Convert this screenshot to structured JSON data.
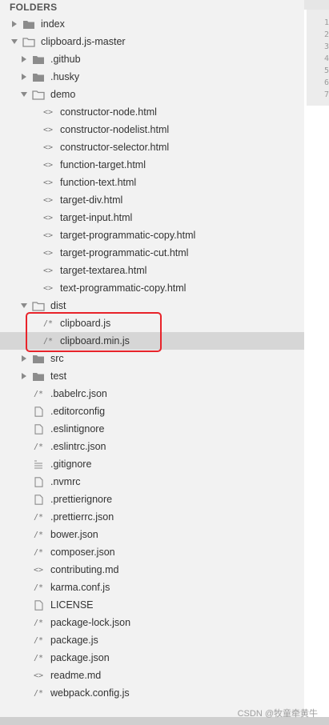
{
  "sidebar": {
    "title": "FOLDERS",
    "items": [
      {
        "label": "index",
        "icon": "folder-icon",
        "arrow": "right",
        "depth": 0
      },
      {
        "label": "clipboard.js-master",
        "icon": "folder-open-icon",
        "arrow": "down",
        "depth": 0
      },
      {
        "label": ".github",
        "icon": "folder-icon",
        "arrow": "right",
        "depth": 1
      },
      {
        "label": ".husky",
        "icon": "folder-icon",
        "arrow": "right",
        "depth": 1
      },
      {
        "label": "demo",
        "icon": "folder-open-icon",
        "arrow": "down",
        "depth": 1
      },
      {
        "label": "constructor-node.html",
        "icon": "code-file-icon",
        "glyph": "<>",
        "depth": 2
      },
      {
        "label": "constructor-nodelist.html",
        "icon": "code-file-icon",
        "glyph": "<>",
        "depth": 2
      },
      {
        "label": "constructor-selector.html",
        "icon": "code-file-icon",
        "glyph": "<>",
        "depth": 2
      },
      {
        "label": "function-target.html",
        "icon": "code-file-icon",
        "glyph": "<>",
        "depth": 2
      },
      {
        "label": "function-text.html",
        "icon": "code-file-icon",
        "glyph": "<>",
        "depth": 2
      },
      {
        "label": "target-div.html",
        "icon": "code-file-icon",
        "glyph": "<>",
        "depth": 2
      },
      {
        "label": "target-input.html",
        "icon": "code-file-icon",
        "glyph": "<>",
        "depth": 2
      },
      {
        "label": "target-programmatic-copy.html",
        "icon": "code-file-icon",
        "glyph": "<>",
        "depth": 2
      },
      {
        "label": "target-programmatic-cut.html",
        "icon": "code-file-icon",
        "glyph": "<>",
        "depth": 2
      },
      {
        "label": "target-textarea.html",
        "icon": "code-file-icon",
        "glyph": "<>",
        "depth": 2
      },
      {
        "label": "text-programmatic-copy.html",
        "icon": "code-file-icon",
        "glyph": "<>",
        "depth": 2
      },
      {
        "label": "dist",
        "icon": "folder-open-icon",
        "arrow": "down",
        "depth": 1
      },
      {
        "label": "clipboard.js",
        "icon": "script-file-icon",
        "glyph": "/*",
        "depth": 2
      },
      {
        "label": "clipboard.min.js",
        "icon": "script-file-icon",
        "glyph": "/*",
        "depth": 2,
        "selected": true
      },
      {
        "label": "src",
        "icon": "folder-icon",
        "arrow": "right",
        "depth": 1
      },
      {
        "label": "test",
        "icon": "folder-icon",
        "arrow": "right",
        "depth": 1
      },
      {
        "label": ".babelrc.json",
        "icon": "script-file-icon",
        "glyph": "/*",
        "depth": 1
      },
      {
        "label": ".editorconfig",
        "icon": "plain-file-icon",
        "depth": 1
      },
      {
        "label": ".eslintignore",
        "icon": "plain-file-icon",
        "depth": 1
      },
      {
        "label": ".eslintrc.json",
        "icon": "script-file-icon",
        "glyph": "/*",
        "depth": 1
      },
      {
        "label": ".gitignore",
        "icon": "list-file-icon",
        "depth": 1
      },
      {
        "label": ".nvmrc",
        "icon": "plain-file-icon",
        "depth": 1
      },
      {
        "label": ".prettierignore",
        "icon": "plain-file-icon",
        "depth": 1
      },
      {
        "label": ".prettierrc.json",
        "icon": "script-file-icon",
        "glyph": "/*",
        "depth": 1
      },
      {
        "label": "bower.json",
        "icon": "script-file-icon",
        "glyph": "/*",
        "depth": 1
      },
      {
        "label": "composer.json",
        "icon": "script-file-icon",
        "glyph": "/*",
        "depth": 1
      },
      {
        "label": "contributing.md",
        "icon": "code-file-icon",
        "glyph": "<>",
        "depth": 1
      },
      {
        "label": "karma.conf.js",
        "icon": "script-file-icon",
        "glyph": "/*",
        "depth": 1
      },
      {
        "label": "LICENSE",
        "icon": "plain-file-icon",
        "depth": 1
      },
      {
        "label": "package-lock.json",
        "icon": "script-file-icon",
        "glyph": "/*",
        "depth": 1
      },
      {
        "label": "package.js",
        "icon": "script-file-icon",
        "glyph": "/*",
        "depth": 1
      },
      {
        "label": "package.json",
        "icon": "script-file-icon",
        "glyph": "/*",
        "depth": 1
      },
      {
        "label": "readme.md",
        "icon": "code-file-icon",
        "glyph": "<>",
        "depth": 1
      },
      {
        "label": "webpack.config.js",
        "icon": "script-file-icon",
        "glyph": "/*",
        "depth": 1
      }
    ]
  },
  "gutter": {
    "line_numbers": [
      "1",
      "2",
      "3",
      "4",
      "5",
      "6",
      "7"
    ]
  },
  "watermark": "CSDN @牧童牵黄牛",
  "colors": {
    "sidebar_bg": "#f2f2f2",
    "selected_bg": "#d6d6d6",
    "highlight_border": "#e8232a"
  }
}
